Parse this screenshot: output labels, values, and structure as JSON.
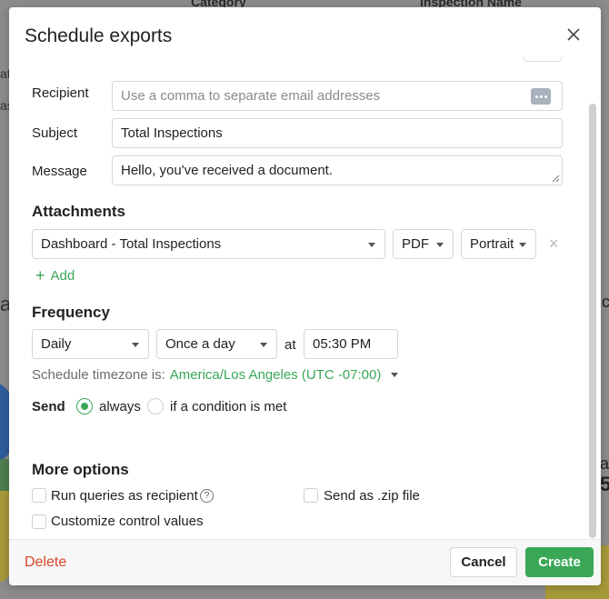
{
  "background": {
    "header_category": "Category",
    "header_inspection_name": "Inspection Name",
    "left_fragments": [
      "at",
      "as",
      "a"
    ],
    "right_fragments": [
      "c",
      "al",
      "5"
    ]
  },
  "dialog": {
    "title": "Schedule exports",
    "close_icon": "close-icon"
  },
  "recipient": {
    "label": "Recipient",
    "placeholder": "Use a comma to separate email addresses",
    "value": ""
  },
  "subject": {
    "label": "Subject",
    "value": "Total Inspections"
  },
  "message": {
    "label": "Message",
    "value": "Hello, you've received a document."
  },
  "attachments": {
    "title": "Attachments",
    "items": [
      {
        "dashboard": "Dashboard - Total Inspections",
        "format": "PDF",
        "orientation": "Portrait",
        "remove_glyph": "×"
      }
    ],
    "add_label": "Add",
    "add_glyph": "+"
  },
  "frequency": {
    "title": "Frequency",
    "period": "Daily",
    "times": "Once a day",
    "at_label": "at",
    "time": "05:30 PM",
    "timezone_prefix": "Schedule timezone is:",
    "timezone": "America/Los Angeles (UTC -07:00)"
  },
  "send": {
    "label": "Send",
    "options": [
      {
        "label": "always",
        "checked": true
      },
      {
        "label": "if a condition is met",
        "checked": false
      }
    ]
  },
  "more_options": {
    "title": "More options",
    "run_as_recipient": {
      "label": "Run queries as recipient",
      "checked": false,
      "help_glyph": "?"
    },
    "send_zip": {
      "label": "Send as .zip file",
      "checked": false
    },
    "customize_controls": {
      "label": "Customize control values",
      "checked": false
    }
  },
  "footer": {
    "delete_label": "Delete",
    "cancel_label": "Cancel",
    "create_label": "Create"
  },
  "colors": {
    "accent": "#3aa757",
    "danger": "#d9452b",
    "overlay": "#8c8c8c"
  }
}
